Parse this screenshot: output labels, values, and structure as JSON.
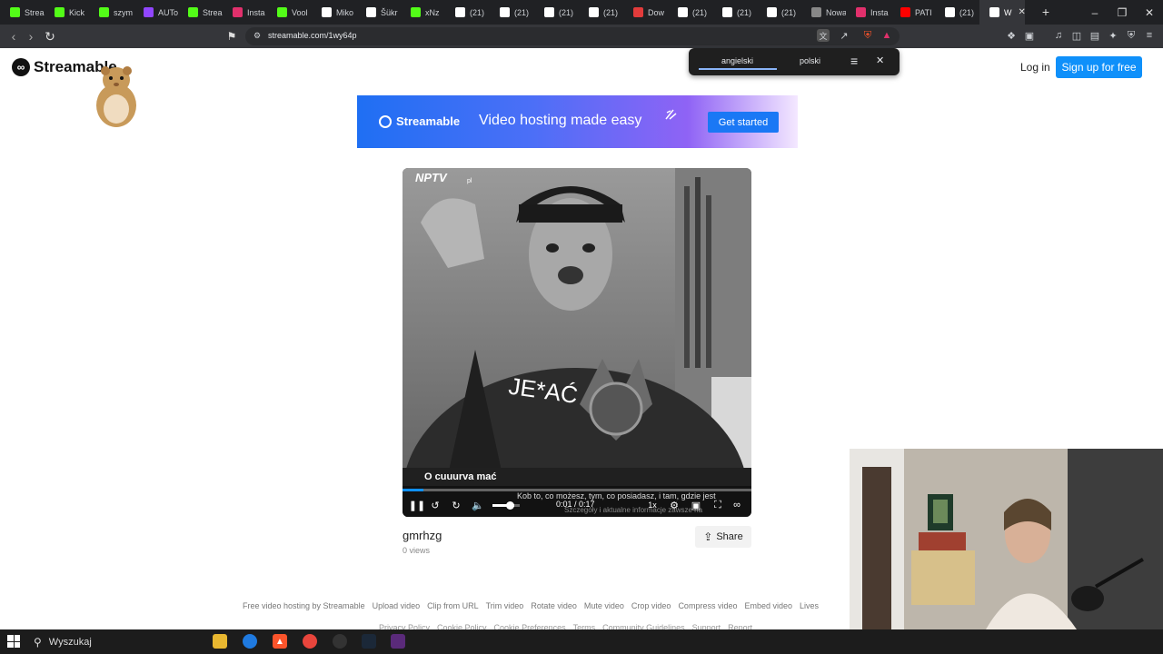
{
  "browser": {
    "tabs": [
      {
        "label": "Strea",
        "icon": "kick-icon",
        "color": "#53fc18"
      },
      {
        "label": "Kick",
        "icon": "kick-icon",
        "color": "#53fc18"
      },
      {
        "label": "szym",
        "icon": "kick-icon",
        "color": "#53fc18"
      },
      {
        "label": "AUTo",
        "icon": "twitch-icon",
        "color": "#9146ff"
      },
      {
        "label": "Strea",
        "icon": "kick-icon",
        "color": "#53fc18"
      },
      {
        "label": "Insta",
        "icon": "instagram-icon",
        "color": "#e1306c"
      },
      {
        "label": "Vool",
        "icon": "kick-icon",
        "color": "#53fc18"
      },
      {
        "label": "Miko",
        "icon": "tiktok-icon",
        "color": "#ffffff"
      },
      {
        "label": "Šükr",
        "icon": "tiktok-icon",
        "color": "#ffffff"
      },
      {
        "label": "xNz",
        "icon": "kick-icon",
        "color": "#53fc18"
      },
      {
        "label": "(21)",
        "icon": "x-icon",
        "color": "#ffffff"
      },
      {
        "label": "(21)",
        "icon": "x-icon",
        "color": "#ffffff"
      },
      {
        "label": "(21)",
        "icon": "x-icon",
        "color": "#ffffff"
      },
      {
        "label": "(21)",
        "icon": "x-icon",
        "color": "#ffffff"
      },
      {
        "label": "Dow",
        "icon": "tubi-icon",
        "color": "#e23b3b"
      },
      {
        "label": "(21)",
        "icon": "x-icon",
        "color": "#ffffff"
      },
      {
        "label": "(21)",
        "icon": "x-icon",
        "color": "#ffffff"
      },
      {
        "label": "(21)",
        "icon": "x-icon",
        "color": "#ffffff"
      },
      {
        "label": "Nowa k",
        "icon": "none",
        "color": "#888888"
      },
      {
        "label": "Insta",
        "icon": "instagram-icon",
        "color": "#e1306c"
      },
      {
        "label": "PATI",
        "icon": "youtube-icon",
        "color": "#ff0000"
      },
      {
        "label": "(21)",
        "icon": "x-icon",
        "color": "#ffffff"
      },
      {
        "label": "W",
        "icon": "audio-icon",
        "color": "#ffffff",
        "active": true
      }
    ],
    "url": "streamable.com/1wy64p"
  },
  "translate_popup": {
    "source_lang": "angielski",
    "target_lang": "polski"
  },
  "header": {
    "logo_text": "Streamable",
    "login_label": "Log in",
    "signup_label": "Sign up for free"
  },
  "banner": {
    "brand": "Streamable",
    "tagline": "Video hosting made easy",
    "cta": "Get started"
  },
  "video": {
    "watermark": "NPTV",
    "watermark_suffix": "pl",
    "overlay_caption": "JE*AĆ",
    "lower_third": "O cuuurva mać",
    "ticker": "Kob to, co możesz, tym, co posiadasz, i tam, gdzie jest",
    "ticker2": "Szczegóły i aktualne informacje zawsze na",
    "time": "0:01 / 0:17",
    "speed": "1x",
    "progress": 0.06,
    "volume": 0.8,
    "title": "gmrhzg",
    "views": "0 views",
    "share_label": "Share"
  },
  "footer": {
    "links": [
      "Free video hosting by Streamable",
      "Upload video",
      "Clip from URL",
      "Trim video",
      "Rotate video",
      "Mute video",
      "Crop video",
      "Compress video",
      "Embed video",
      "Lives"
    ],
    "links2": [
      "Privacy Policy",
      "Cookie Policy",
      "Cookie Preferences",
      "Terms",
      "Community Guidelines",
      "Support",
      "Report"
    ]
  },
  "taskbar": {
    "search_placeholder": "Wyszukaj"
  }
}
